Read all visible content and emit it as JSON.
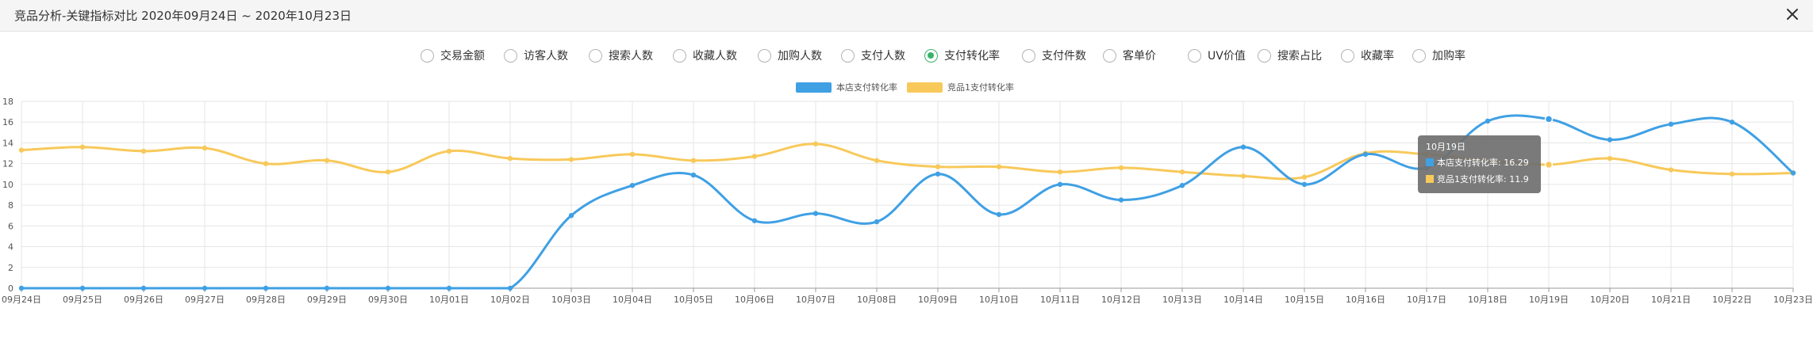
{
  "window": {
    "title": "竞品分析-关键指标对比 2020年09月24日 ~ 2020年10月23日",
    "close_icon": "close-icon"
  },
  "metrics": {
    "selected": "支付转化率",
    "items": [
      "交易金额",
      "访客人数",
      "搜索人数",
      "收藏人数",
      "加购人数",
      "支付人数",
      "支付转化率",
      "支付件数",
      "客单价",
      "UV价值",
      "搜索占比",
      "收藏率",
      "加购率"
    ]
  },
  "colors": {
    "series1": "#3fa0e4",
    "series2": "#f8c95a",
    "radio_selected": "#3ab26a",
    "grid": "#e6e6e6",
    "tooltip_bg": "#6f6f6f"
  },
  "chart_data": {
    "type": "line",
    "smooth": true,
    "grid": true,
    "legend_position": "top-center",
    "categories": [
      "09月24日",
      "09月25日",
      "09月26日",
      "09月27日",
      "09月28日",
      "09月29日",
      "09月30日",
      "10月01日",
      "10月02日",
      "10月03日",
      "10月04日",
      "10月05日",
      "10月06日",
      "10月07日",
      "10月08日",
      "10月09日",
      "10月10日",
      "10月11日",
      "10月12日",
      "10月13日",
      "10月14日",
      "10月15日",
      "10月16日",
      "10月17日",
      "10月18日",
      "10月19日",
      "10月20日",
      "10月21日",
      "10月22日",
      "10月23日"
    ],
    "yticks": [
      "0",
      "2",
      "4",
      "6",
      "8",
      "10",
      "12",
      "14",
      "16",
      "18"
    ],
    "ylim": [
      0,
      18
    ],
    "series": [
      {
        "name": "本店支付转化率",
        "values": [
          0,
          0,
          0,
          0,
          0,
          0,
          0,
          0,
          0,
          7.0,
          9.9,
          10.9,
          6.5,
          7.2,
          6.4,
          11.0,
          7.1,
          10.0,
          8.5,
          9.9,
          13.6,
          10.0,
          12.9,
          11.6,
          16.1,
          16.29,
          14.3,
          15.8,
          16.0,
          11.1
        ]
      },
      {
        "name": "竞品1支付转化率",
        "values": [
          13.3,
          13.6,
          13.2,
          13.5,
          12.0,
          12.3,
          11.2,
          13.2,
          12.5,
          12.4,
          12.9,
          12.3,
          12.7,
          13.9,
          12.3,
          11.7,
          11.7,
          11.2,
          11.6,
          11.2,
          10.8,
          10.7,
          13.0,
          12.9,
          12.3,
          11.9,
          12.5,
          11.4,
          11.0,
          11.1
        ]
      }
    ],
    "tooltip": {
      "date": "10月19日",
      "rows": [
        "本店支付转化率: 16.29",
        "竞品1支付转化率: 11.9"
      ]
    }
  }
}
